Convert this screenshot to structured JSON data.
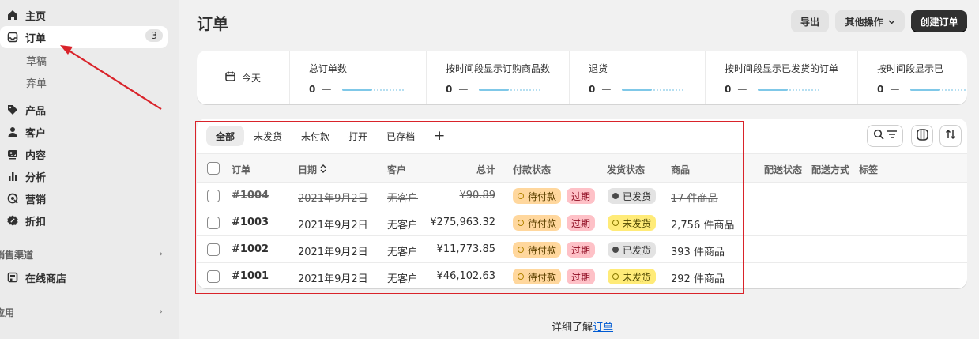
{
  "sidebar": {
    "items": [
      {
        "label": "主页",
        "icon": "home-icon"
      },
      {
        "label": "订单",
        "icon": "inbox-icon",
        "badge": "3"
      },
      {
        "label": "产品",
        "icon": "tag-icon"
      },
      {
        "label": "客户",
        "icon": "person-icon"
      },
      {
        "label": "内容",
        "icon": "content-icon"
      },
      {
        "label": "分析",
        "icon": "bar-chart-icon"
      },
      {
        "label": "营销",
        "icon": "target-icon"
      },
      {
        "label": "折扣",
        "icon": "discount-icon"
      }
    ],
    "subitems": [
      "草稿",
      "弃单"
    ],
    "sales_channels": {
      "label": "销售渠道",
      "items": [
        {
          "label": "在线商店",
          "icon": "store-icon"
        }
      ]
    },
    "apps": {
      "label": "应用"
    }
  },
  "header": {
    "title": "订单",
    "export_label": "导出",
    "more_label": "其他操作",
    "create_label": "创建订单"
  },
  "stats": {
    "date_label": "今天",
    "items": [
      {
        "label": "总订单数",
        "value": "0",
        "dash": "—"
      },
      {
        "label": "按时间段显示订购商品数",
        "value": "0",
        "dash": "—"
      },
      {
        "label": "退货",
        "value": "0",
        "dash": "—"
      },
      {
        "label": "按时间段显示已发货的订单",
        "value": "0",
        "dash": "—"
      },
      {
        "label": "按时间段显示已",
        "value": "0",
        "dash": "—"
      }
    ]
  },
  "tabs": [
    "全部",
    "未发货",
    "未付款",
    "打开",
    "已存档",
    "+"
  ],
  "table": {
    "columns": [
      "订单",
      "日期",
      "客户",
      "总计",
      "付款状态",
      "发货状态",
      "商品",
      "配送状态",
      "配送方式",
      "标签"
    ],
    "rows": [
      {
        "order": "#1004",
        "date": "2021年9月2日",
        "customer": "无客户",
        "total": "¥90.89",
        "payment": "待付款",
        "overdue": "过期",
        "fulfillment": "已发货",
        "items": "17 件商品"
      },
      {
        "order": "#1003",
        "date": "2021年9月2日",
        "customer": "无客户",
        "total": "¥275,963.32",
        "payment": "待付款",
        "overdue": "过期",
        "fulfillment": "未发货",
        "items": "2,756 件商品"
      },
      {
        "order": "#1002",
        "date": "2021年9月2日",
        "customer": "无客户",
        "total": "¥11,773.85",
        "payment": "待付款",
        "overdue": "过期",
        "fulfillment": "已发货",
        "items": "393 件商品"
      },
      {
        "order": "#1001",
        "date": "2021年9月2日",
        "customer": "无客户",
        "total": "¥46,102.63",
        "payment": "待付款",
        "overdue": "过期",
        "fulfillment": "未发货",
        "items": "292 件商品"
      }
    ]
  },
  "footer": {
    "prefix": "详细了解",
    "link": "订单"
  },
  "colors": {
    "accent": "#303030",
    "highlight": "#d9232a",
    "link": "#005bd3"
  }
}
